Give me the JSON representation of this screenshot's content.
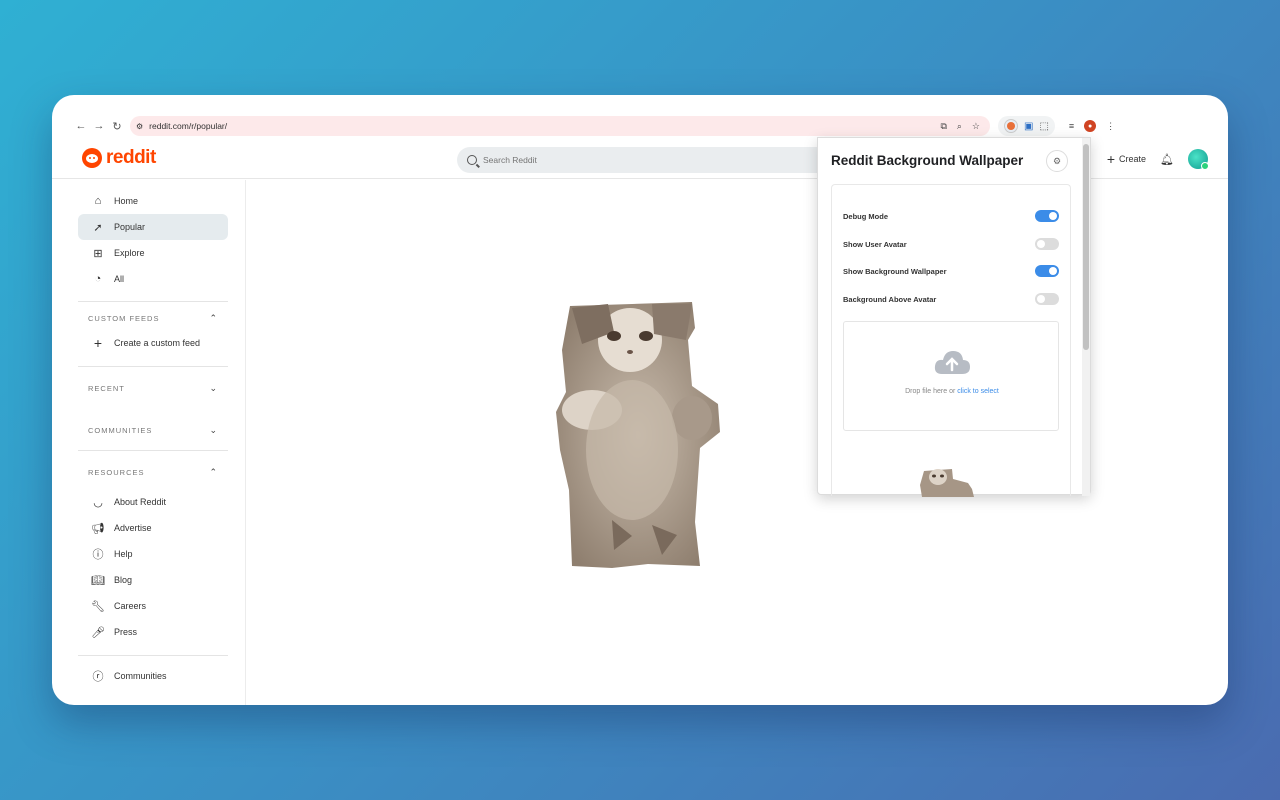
{
  "browser": {
    "url": "reddit.com/r/popular/"
  },
  "header": {
    "logo_text": "reddit",
    "search_placeholder": "Search Reddit",
    "create_label": "Create"
  },
  "sidebar": {
    "nav": [
      {
        "label": "Home",
        "icon": "home-icon"
      },
      {
        "label": "Popular",
        "icon": "popular-icon"
      },
      {
        "label": "Explore",
        "icon": "explore-icon"
      },
      {
        "label": "All",
        "icon": "all-icon"
      }
    ],
    "custom_feeds_heading": "CUSTOM FEEDS",
    "create_custom_feed": "Create a custom feed",
    "recent_heading": "RECENT",
    "communities_heading": "COMMUNITIES",
    "resources_heading": "RESOURCES",
    "resources": [
      {
        "label": "About Reddit",
        "icon": "reddit-alien-icon"
      },
      {
        "label": "Advertise",
        "icon": "megaphone-icon"
      },
      {
        "label": "Help",
        "icon": "help-icon"
      },
      {
        "label": "Blog",
        "icon": "book-icon"
      },
      {
        "label": "Careers",
        "icon": "wrench-icon"
      },
      {
        "label": "Press",
        "icon": "microphone-icon"
      }
    ],
    "communities_link": "Communities"
  },
  "popup": {
    "title": "Reddit Background Wallpaper",
    "options": [
      {
        "label": "Debug Mode",
        "on": true
      },
      {
        "label": "Show User Avatar",
        "on": false
      },
      {
        "label": "Show Background Wallpaper",
        "on": true
      },
      {
        "label": "Background Above Avatar",
        "on": false
      }
    ],
    "drop_text": "Drop file here or ",
    "drop_link": "click to select"
  },
  "colors": {
    "brand": "#ff4500",
    "toggle_on": "#3b8ce8",
    "toggle_off": "#dcdcdc"
  }
}
